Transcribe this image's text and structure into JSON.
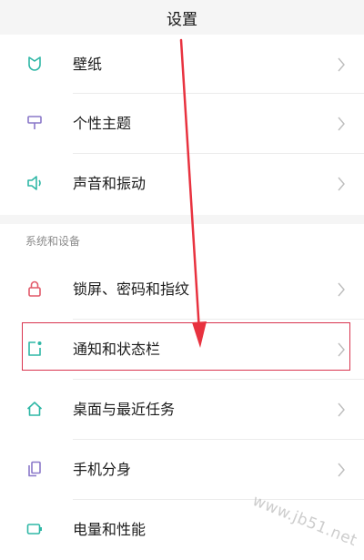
{
  "header": {
    "title": "设置"
  },
  "items_top": [
    {
      "label": "壁纸",
      "icon": "wallpaper-icon"
    },
    {
      "label": "个性主题",
      "icon": "theme-brush-icon"
    },
    {
      "label": "声音和振动",
      "icon": "speaker-icon"
    }
  ],
  "section": {
    "title": "系统和设备"
  },
  "items_system": [
    {
      "label": "锁屏、密码和指纹",
      "icon": "lock-icon"
    },
    {
      "label": "通知和状态栏",
      "icon": "notification-icon"
    },
    {
      "label": "桌面与最近任务",
      "icon": "home-icon"
    },
    {
      "label": "手机分身",
      "icon": "phone-clone-icon"
    },
    {
      "label": "电量和性能",
      "icon": "battery-icon"
    }
  ],
  "watermark": "www.jb51.net",
  "colors": {
    "accent_teal": "#2fb7a6",
    "lock_red": "#e25a6a",
    "theme_purple": "#8a78c9",
    "highlight_red": "#d9344f"
  }
}
